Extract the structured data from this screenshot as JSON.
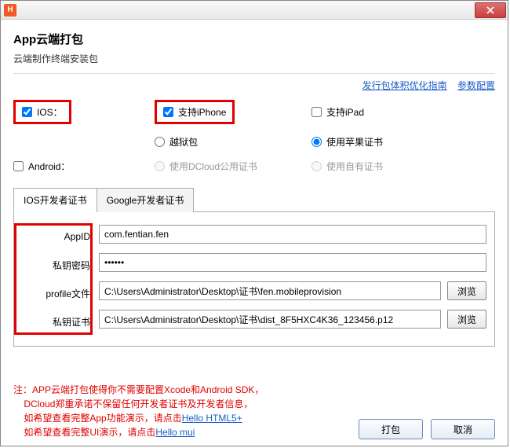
{
  "titlebar": {
    "icon_letter": "H"
  },
  "header": {
    "title": "App云端打包",
    "subtitle": "云端制作终端安装包"
  },
  "links": {
    "guide": "发行包体积优化指南",
    "config": "参数配置"
  },
  "options": {
    "ios_label": "IOS：",
    "support_iphone": "支持iPhone",
    "support_ipad": "支持iPad",
    "jailbreak": "越狱包",
    "apple_cert": "使用苹果证书",
    "android_label": "Android：",
    "dcloud_cert": "使用DCloud公用证书",
    "own_cert": "使用自有证书"
  },
  "tabs": {
    "ios": "IOS开发者证书",
    "google": "Google开发者证书"
  },
  "form": {
    "appid_label": "AppID",
    "appid_value": "com.fentian.fen",
    "pwd_label": "私钥密码",
    "pwd_value": "••••••",
    "profile_label": "profile文件",
    "profile_value": "C:\\Users\\Administrator\\Desktop\\证书\\fen.mobileprovision",
    "cert_label": "私钥证书",
    "cert_value": "C:\\Users\\Administrator\\Desktop\\证书\\dist_8F5HXC4K36_123456.p12",
    "browse": "浏览"
  },
  "note": {
    "prefix": "注：",
    "line1": "APP云端打包使得你不需要配置Xcode和Android SDK，",
    "line2": "DCloud郑重承诺不保留任何开发者证书及开发者信息，",
    "line3a": "如希望查看完整App功能演示，请点击",
    "link1": "Hello HTML5+",
    "line4a": "如希望查看完整UI演示，请点击",
    "link2": "Hello mui"
  },
  "buttons": {
    "pack": "打包",
    "cancel": "取消"
  }
}
